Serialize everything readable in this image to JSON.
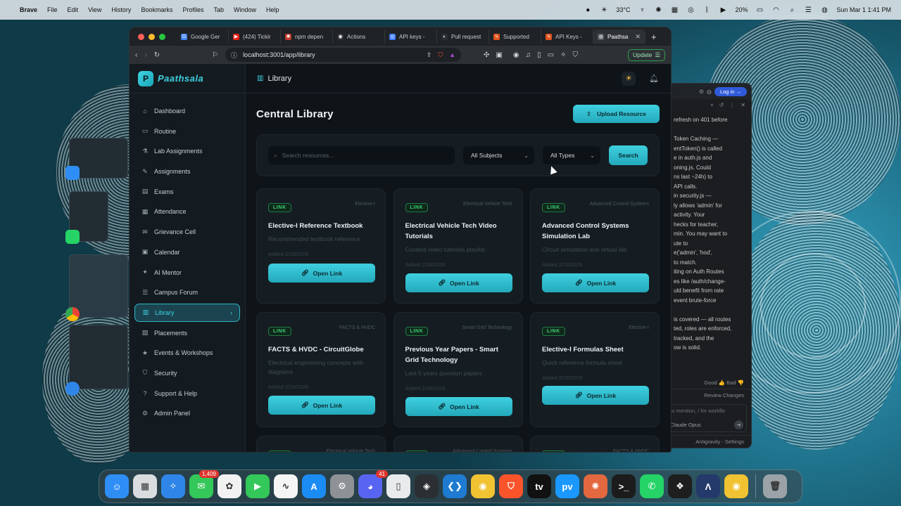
{
  "menubar": {
    "app_name": "Brave",
    "items": [
      "File",
      "Edit",
      "View",
      "History",
      "Bookmarks",
      "Profiles",
      "Tab",
      "Window",
      "Help"
    ],
    "temperature": "33°C",
    "battery": "20%",
    "datetime": "Sun Mar 1  1:41 PM"
  },
  "browser": {
    "tabs": [
      {
        "label": "Google Ger",
        "icon_color": "#4285f4",
        "icon": "G"
      },
      {
        "label": "(424) Tickir",
        "icon_color": "#e62117",
        "icon": "▶"
      },
      {
        "label": "npm depen",
        "icon_color": "#c0392b",
        "icon": "✺"
      },
      {
        "label": "Actions",
        "icon_color": "#2b2f33",
        "icon": "◉"
      },
      {
        "label": "API keys -",
        "icon_color": "#3e7cff",
        "icon": "◎"
      },
      {
        "label": "Pull request",
        "icon_color": "#2b2f33",
        "icon": "◐"
      },
      {
        "label": "Supported",
        "icon_color": "#e2541f",
        "icon": "ϟ"
      },
      {
        "label": "API Keys -",
        "icon_color": "#e2541f",
        "icon": "ϟ"
      },
      {
        "label": "Paathsa",
        "icon_color": "#555b60",
        "icon": "◍"
      }
    ],
    "url": "localhost:3001/app/library",
    "update_label": "Update"
  },
  "app": {
    "brand": "Paathsala",
    "brand_letter": "P",
    "breadcrumb": "Library",
    "nav": [
      {
        "label": "Dashboard",
        "icon": "⌂"
      },
      {
        "label": "Routine",
        "icon": "▭"
      },
      {
        "label": "Lab Assignments",
        "icon": "⚗"
      },
      {
        "label": "Assignments",
        "icon": "✎"
      },
      {
        "label": "Exams",
        "icon": "▤"
      },
      {
        "label": "Attendance",
        "icon": "▦"
      },
      {
        "label": "Grievance Cell",
        "icon": "✉"
      },
      {
        "label": "Calendar",
        "icon": "▣"
      },
      {
        "label": "AI Mentor",
        "icon": "✦"
      },
      {
        "label": "Campus Forum",
        "icon": "☰"
      },
      {
        "label": "Library",
        "icon": "▥"
      },
      {
        "label": "Placements",
        "icon": "▧"
      },
      {
        "label": "Events & Workshops",
        "icon": "★"
      },
      {
        "label": "Security",
        "icon": "⛉"
      },
      {
        "label": "Support & Help",
        "icon": "?"
      },
      {
        "label": "Admin Panel",
        "icon": "⚙"
      }
    ],
    "page_title": "Central Library",
    "upload_label": "Upload Resource",
    "search_placeholder": "Search resources...",
    "subject_filter": "All Subjects",
    "type_filter": "All Types",
    "search_label": "Search",
    "cards": [
      {
        "badge": "LINK",
        "subject": "Elective-I",
        "title": "Elective-I Reference Textbook",
        "desc": "Recommended textbook reference",
        "date": "Added 2/28/2026",
        "action": "Open Link"
      },
      {
        "badge": "LINK",
        "subject": "Electrical Vehicle Tech",
        "title": "Electrical Vehicle Tech Video Tutorials",
        "desc": "Curated video tutorials playlist",
        "date": "Added 2/28/2026",
        "action": "Open Link"
      },
      {
        "badge": "LINK",
        "subject": "Advanced Control Systems",
        "title": "Advanced Control Systems Simulation Lab",
        "desc": "Circuit simulation and virtual lab",
        "date": "Added 2/28/2026",
        "action": "Open Link"
      },
      {
        "badge": "LINK",
        "subject": "FACTS & HVDC",
        "title": "FACTS & HVDC - CircuitGlobe",
        "desc": "Electrical engineering concepts with diagrams",
        "date": "Added 2/28/2026",
        "action": "Open Link"
      },
      {
        "badge": "LINK",
        "subject": "Smart Grid Technology",
        "title": "Previous Year Papers - Smart Grid Technology",
        "desc": "Last 5 years question papers",
        "date": "Added 2/28/2026",
        "action": "Open Link"
      },
      {
        "badge": "LINK",
        "subject": "Elective-I",
        "title": "Elective-I Formulas Sheet",
        "desc": "Quick reference formula sheet",
        "date": "Added 2/28/2026",
        "action": "Open Link"
      }
    ],
    "partial_cards": [
      {
        "badge": "LINK",
        "subject": "Electrical Vehicle Tech"
      },
      {
        "badge": "LINK",
        "subject": "Advanced Control Systems"
      },
      {
        "badge": "LINK",
        "subject": "FACTS & HVDC"
      }
    ]
  },
  "side_window": {
    "login_label": "Log in →",
    "lines": [
      "refresh on 401 before",
      "",
      "Token Caching —",
      "entToken() is called",
      "e in auth.js and",
      "oning.js. Could",
      "ns last ~24h) to",
      "API calls.",
      "in security.js —",
      "ly allows 'admin' for",
      "activity. Your",
      "hecks for teacher,",
      "min. You may want to",
      "ute to",
      "e('admin', 'hod',",
      "to match.",
      "iting on Auth Routes",
      "es like /auth/change-",
      "uld benefit from rate",
      "event brute-force",
      "",
      "is covered — all routes",
      "ted, roles are enforced,",
      "tracked, and the",
      "ow is solid."
    ],
    "feedback": "Good 👍  Bad 👎",
    "review_label": "Review Changes",
    "input_placeholder": "to mention, / for workflo",
    "model": "Claude Opus",
    "footer": "Antigravity - Settings"
  },
  "dock": {
    "apps": [
      {
        "name": "finder",
        "color": "#2f8ef5",
        "glyph": "☺"
      },
      {
        "name": "launchpad",
        "color": "#d9dde0",
        "glyph": "▦"
      },
      {
        "name": "safari",
        "color": "#2f86e8",
        "glyph": "✧"
      },
      {
        "name": "messages",
        "color": "#34c759",
        "glyph": "✉",
        "badge": "1,409"
      },
      {
        "name": "photos",
        "color": "#f2f2f2",
        "glyph": "✿"
      },
      {
        "name": "facetime",
        "color": "#34c759",
        "glyph": "▶"
      },
      {
        "name": "freeform",
        "color": "#f5f5f5",
        "glyph": "∿"
      },
      {
        "name": "app-store",
        "color": "#1c8cf5",
        "glyph": "A"
      },
      {
        "name": "system-settings",
        "color": "#8e9296",
        "glyph": "⚙"
      },
      {
        "name": "discord",
        "color": "#5865f2",
        "glyph": "◕",
        "badge": "41"
      },
      {
        "name": "iphone-mirroring",
        "color": "#e8eaec",
        "glyph": "▯"
      },
      {
        "name": "davinci-resolve",
        "color": "#2b2f33",
        "glyph": "◈"
      },
      {
        "name": "vscode",
        "color": "#1f7bd1",
        "glyph": "❮❯"
      },
      {
        "name": "chrome",
        "color": "#f1c232",
        "glyph": "◉"
      },
      {
        "name": "brave",
        "color": "#fb542b",
        "glyph": "⛉"
      },
      {
        "name": "apple-tv",
        "color": "#111111",
        "glyph": "tv"
      },
      {
        "name": "prime-video",
        "color": "#1a98ff",
        "glyph": "pv"
      },
      {
        "name": "claude",
        "color": "#e4683f",
        "glyph": "✺"
      },
      {
        "name": "terminal",
        "color": "#1c1c1c",
        "glyph": ">_"
      },
      {
        "name": "whatsapp",
        "color": "#25d366",
        "glyph": "✆"
      },
      {
        "name": "figma",
        "color": "#1e1e1e",
        "glyph": "❖"
      },
      {
        "name": "antigravity",
        "color": "#243a6b",
        "glyph": "Λ"
      },
      {
        "name": "chrome-2",
        "color": "#f1c232",
        "glyph": "◉"
      },
      {
        "name": "trash",
        "color": "#9ba3a8",
        "glyph": "🗑"
      }
    ]
  },
  "colors": {
    "accent": "#3fd4e4",
    "badge_green": "#3ccf74",
    "app_bg": "#0f1418"
  }
}
